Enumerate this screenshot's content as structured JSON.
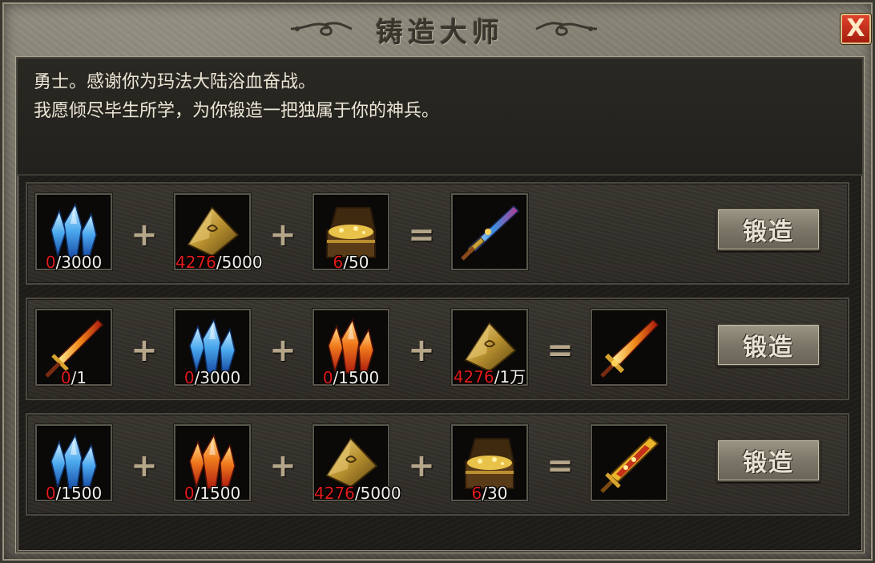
{
  "window": {
    "title": "铸造大师",
    "close_label": "X"
  },
  "message": {
    "line1": "勇士。感谢你为玛法大陆浴血奋战。",
    "line2": "我愿倾尽毕生所学，为你锻造一把独属于你的神兵。"
  },
  "colors": {
    "owned_count": "#e21b1b",
    "close_button": "#c4301a"
  },
  "recipes": [
    {
      "materials": [
        {
          "icon": "blue-crystal-icon",
          "have": "0",
          "need": "/3000"
        },
        {
          "icon": "gold-ingot-icon",
          "have": "4276",
          "need": "/5000"
        },
        {
          "icon": "treasure-chest-icon",
          "have": "6",
          "need": "/50"
        }
      ],
      "plus": "+",
      "equals": "=",
      "result_icon": "blue-sword-icon",
      "button_label": "锻造"
    },
    {
      "materials": [
        {
          "icon": "fire-sword-icon",
          "have": "0",
          "need": "/1"
        },
        {
          "icon": "blue-crystal-icon",
          "have": "0",
          "need": "/3000"
        },
        {
          "icon": "red-crystal-icon",
          "have": "0",
          "need": "/1500"
        },
        {
          "icon": "gold-ingot-icon",
          "have": "4276",
          "need": "/1万"
        }
      ],
      "plus": "+",
      "equals": "=",
      "result_icon": "flame-sword-icon",
      "button_label": "锻造"
    },
    {
      "materials": [
        {
          "icon": "blue-crystal-icon",
          "have": "0",
          "need": "/1500"
        },
        {
          "icon": "red-crystal-icon",
          "have": "0",
          "need": "/1500"
        },
        {
          "icon": "gold-ingot-icon",
          "have": "4276",
          "need": "/5000"
        },
        {
          "icon": "treasure-chest-icon",
          "have": "6",
          "need": "/30"
        }
      ],
      "plus": "+",
      "equals": "=",
      "result_icon": "golden-sword-icon",
      "button_label": "锻造"
    }
  ]
}
